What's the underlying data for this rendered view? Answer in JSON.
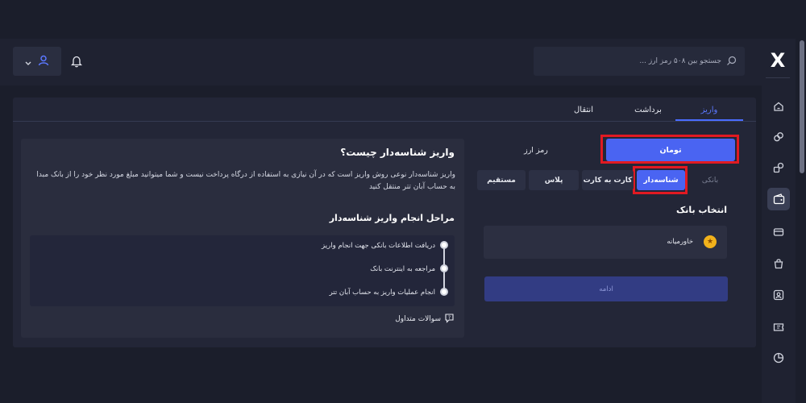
{
  "header": {
    "search_placeholder": "جستجو بین ۵۰۸ رمز ارز ...",
    "logo_text": "X",
    "icons": [
      "user-icon",
      "chevron-down-icon",
      "bell-icon",
      "search-icon"
    ]
  },
  "sidebar": {
    "icons": [
      "home-icon",
      "exchange-icon",
      "convert-icon",
      "wallet-icon",
      "card-icon",
      "bag-icon",
      "user-card-icon",
      "ticket-icon",
      "chart-icon"
    ],
    "active": "wallet-icon"
  },
  "tabs": [
    {
      "label": "واریز",
      "active": true
    },
    {
      "label": "برداشت",
      "active": false
    },
    {
      "label": "انتقال",
      "active": false
    }
  ],
  "deposit": {
    "currency": {
      "toman": "تومان",
      "crypto": "رمز ارز",
      "selected": "toman"
    },
    "methods": [
      {
        "label": "بانکی",
        "state": "plain"
      },
      {
        "label": "شناسه‌دار",
        "state": "active"
      },
      {
        "label": "کارت به کارت",
        "state": "normal"
      },
      {
        "label": "پلاس",
        "state": "normal"
      },
      {
        "label": "مستقیم",
        "state": "normal"
      }
    ],
    "select_bank_label": "انتخاب بانک",
    "bank_name": "خاورمیانه",
    "continue_label": "ادامه"
  },
  "info": {
    "title": "واریز شناسه‌دار چیست؟",
    "text": "واریز شناسه‌دار نوعی روش واریز است که در آن نیازی به استفاده از درگاه پرداخت نیست و شما میتوانید مبلغ مورد نظر خود را از بانک مبدا به حساب آبان تتر منتقل کنید",
    "steps_title": "مراحل انجام واریز شناسه‌دار",
    "steps": [
      "دریافت اطلاعات بانکی جهت انجام واریز",
      "مراجعه به اینترنت بانک",
      "انجام عملیات واریز به حساب آبان تتر"
    ],
    "faq_label": "سوالات متداول"
  },
  "colors": {
    "accent": "#4a64f2",
    "highlight": "#e11a22",
    "panel": "#2a2d3e",
    "background": "#1b1e2b"
  }
}
